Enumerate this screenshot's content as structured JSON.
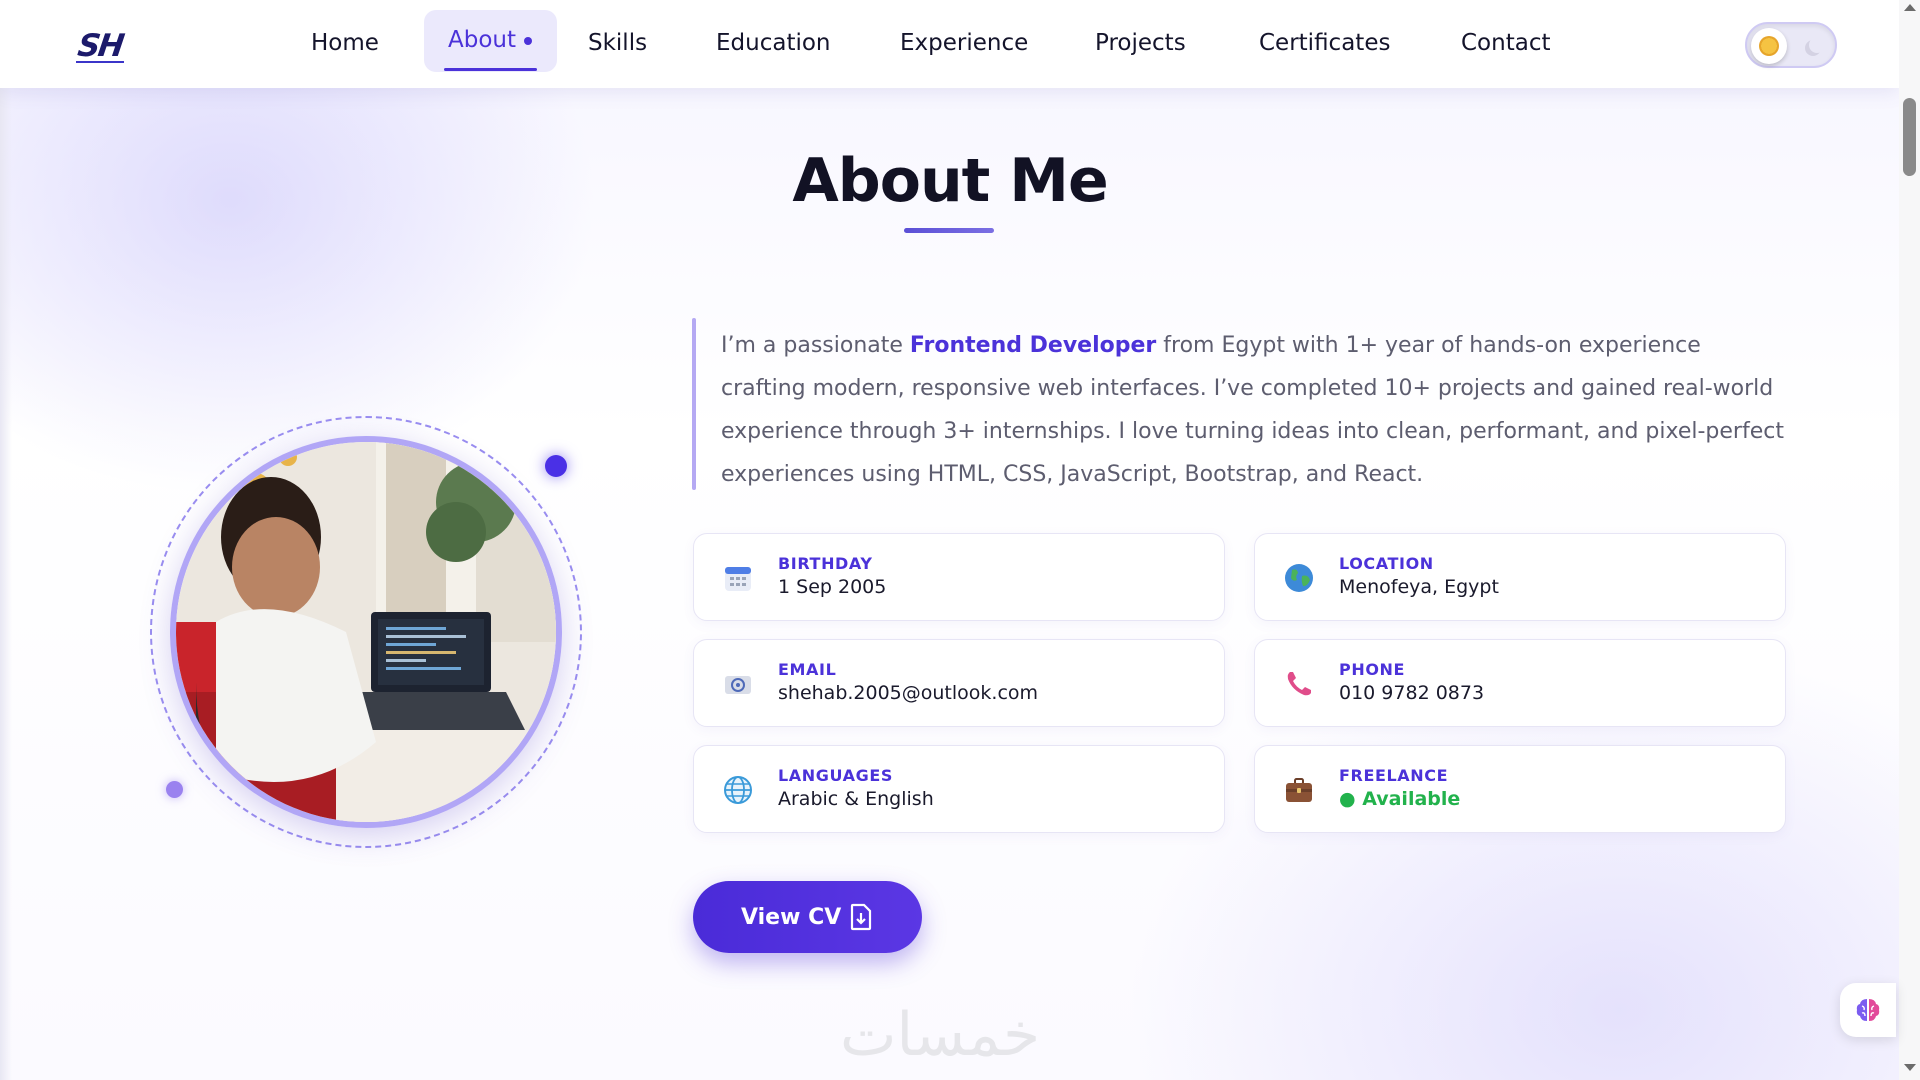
{
  "nav": {
    "logo": "SH",
    "items": [
      "Home",
      "About",
      "Skills",
      "Education",
      "Experience",
      "Projects",
      "Certificates",
      "Contact"
    ],
    "active": "About"
  },
  "about": {
    "title": "About Me",
    "bio_prefix": "I’m a passionate ",
    "bio_highlight": "Frontend Developer",
    "bio_suffix": " from Egypt with 1+ year of hands-on experience crafting modern, responsive web interfaces. I’ve completed 10+ projects and gained real-world experience through 3+ internships. I love turning ideas into clean, performant, and pixel-perfect experiences using HTML, CSS, JavaScript, Bootstrap, and React.",
    "cards": [
      {
        "label": "BIRTHDAY",
        "value": "1 Sep 2005",
        "icon": "calendar-icon"
      },
      {
        "label": "LOCATION",
        "value": "Menofeya, Egypt",
        "icon": "globe-icon"
      },
      {
        "label": "EMAIL",
        "value": "shehab.2005@outlook.com",
        "icon": "email-icon"
      },
      {
        "label": "PHONE",
        "value": "010 9782 0873",
        "icon": "phone-icon"
      },
      {
        "label": "LANGUAGES",
        "value": "Arabic & English",
        "icon": "languages-icon"
      },
      {
        "label": "FREELANCE",
        "value": "● Available",
        "icon": "briefcase-icon"
      }
    ],
    "cv_button": "View CV"
  },
  "watermark": "خمسات",
  "colors": {
    "accent": "#4b32d9",
    "available": "#22b24c"
  }
}
